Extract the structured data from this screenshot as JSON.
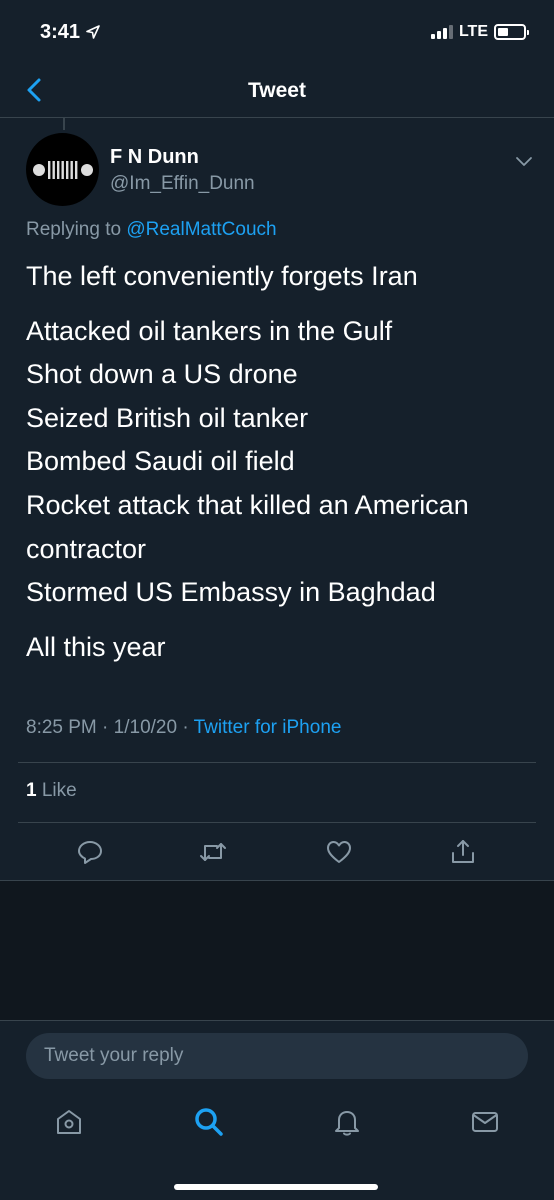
{
  "status_bar": {
    "time": "3:41",
    "network": "LTE"
  },
  "nav": {
    "title": "Tweet"
  },
  "tweet": {
    "author_name": "F N Dunn",
    "author_handle": "@Im_Effin_Dunn",
    "replying_prefix": "Replying to",
    "replying_to": "@RealMattCouch",
    "lines": [
      "The left conveniently forgets Iran",
      "Attacked oil tankers in the Gulf",
      "Shot down a US drone",
      "Seized British oil tanker",
      "Bombed Saudi oil field",
      "Rocket attack that killed an American contractor",
      "Stormed US Embassy in Baghdad",
      "All this year"
    ],
    "time": "8:25 PM",
    "date": "1/10/20",
    "source": "Twitter for iPhone",
    "likes_count": "1",
    "likes_label": "Like"
  },
  "reply": {
    "placeholder": "Tweet your reply"
  },
  "icons": {
    "back": "chevron-left-icon",
    "more": "chevron-down-icon",
    "reply": "comment-icon",
    "retweet": "retweet-icon",
    "like": "heart-icon",
    "share": "share-icon",
    "home": "home-icon",
    "search": "search-icon",
    "notifications": "bell-icon",
    "messages": "mail-icon"
  },
  "colors": {
    "background": "#15202b",
    "accent": "#1da1f2",
    "secondary_text": "#8899a6",
    "divider": "#38444d"
  }
}
